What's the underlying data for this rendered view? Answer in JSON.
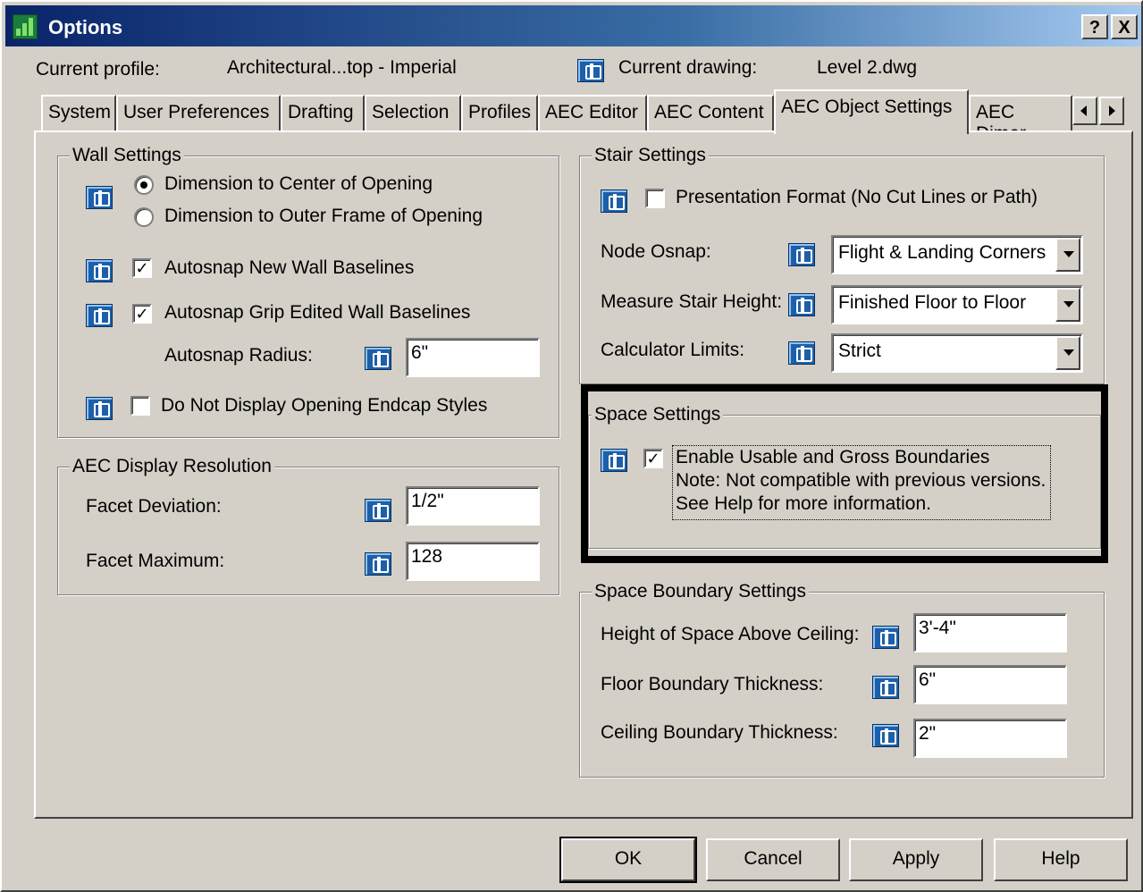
{
  "window": {
    "title": "Options"
  },
  "title_buttons": {
    "help": "?",
    "close": "X"
  },
  "header": {
    "profile_label": "Current profile:",
    "profile_value": "Architectural...top - Imperial",
    "drawing_label": "Current drawing:",
    "drawing_value": "Level 2.dwg"
  },
  "tabs": [
    {
      "label": "System"
    },
    {
      "label": "User Preferences"
    },
    {
      "label": "Drafting"
    },
    {
      "label": "Selection"
    },
    {
      "label": "Profiles"
    },
    {
      "label": "AEC Editor"
    },
    {
      "label": "AEC Content"
    },
    {
      "label": "AEC Object Settings"
    },
    {
      "label": "AEC Dimer"
    }
  ],
  "wall": {
    "group_label": "Wall Settings",
    "radio_center": "Dimension to Center of Opening",
    "radio_outer": "Dimension to Outer Frame of Opening",
    "autosnap_new": "Autosnap New Wall Baselines",
    "autosnap_grip": "Autosnap Grip Edited Wall Baselines",
    "radius_label": "Autosnap Radius:",
    "radius_value": "6\"",
    "endcap": "Do Not Display Opening Endcap Styles"
  },
  "display": {
    "group_label": "AEC Display Resolution",
    "deviation_label": "Facet Deviation:",
    "deviation_value": "1/2\"",
    "maximum_label": "Facet Maximum:",
    "maximum_value": "128"
  },
  "stair": {
    "group_label": "Stair Settings",
    "presentation": "Presentation Format (No Cut Lines or Path)",
    "osnap_label": "Node Osnap:",
    "osnap_value": "Flight & Landing Corners",
    "height_label": "Measure Stair Height:",
    "height_value": "Finished Floor to Floor",
    "calc_label": "Calculator Limits:",
    "calc_value": "Strict"
  },
  "space": {
    "group_label": "Space Settings",
    "line1": "Enable Usable and Gross Boundaries",
    "line2": "Note: Not compatible with previous versions.",
    "line3": "See Help for more information."
  },
  "boundary": {
    "group_label": "Space Boundary Settings",
    "above_label": "Height of Space Above Ceiling:",
    "above_value": "3'-4\"",
    "floor_label": "Floor Boundary Thickness:",
    "floor_value": "6\"",
    "ceiling_label": "Ceiling Boundary Thickness:",
    "ceiling_value": "2\""
  },
  "buttons": {
    "ok": "OK",
    "cancel": "Cancel",
    "apply": "Apply",
    "help": "Help"
  },
  "check_mark": "✓"
}
